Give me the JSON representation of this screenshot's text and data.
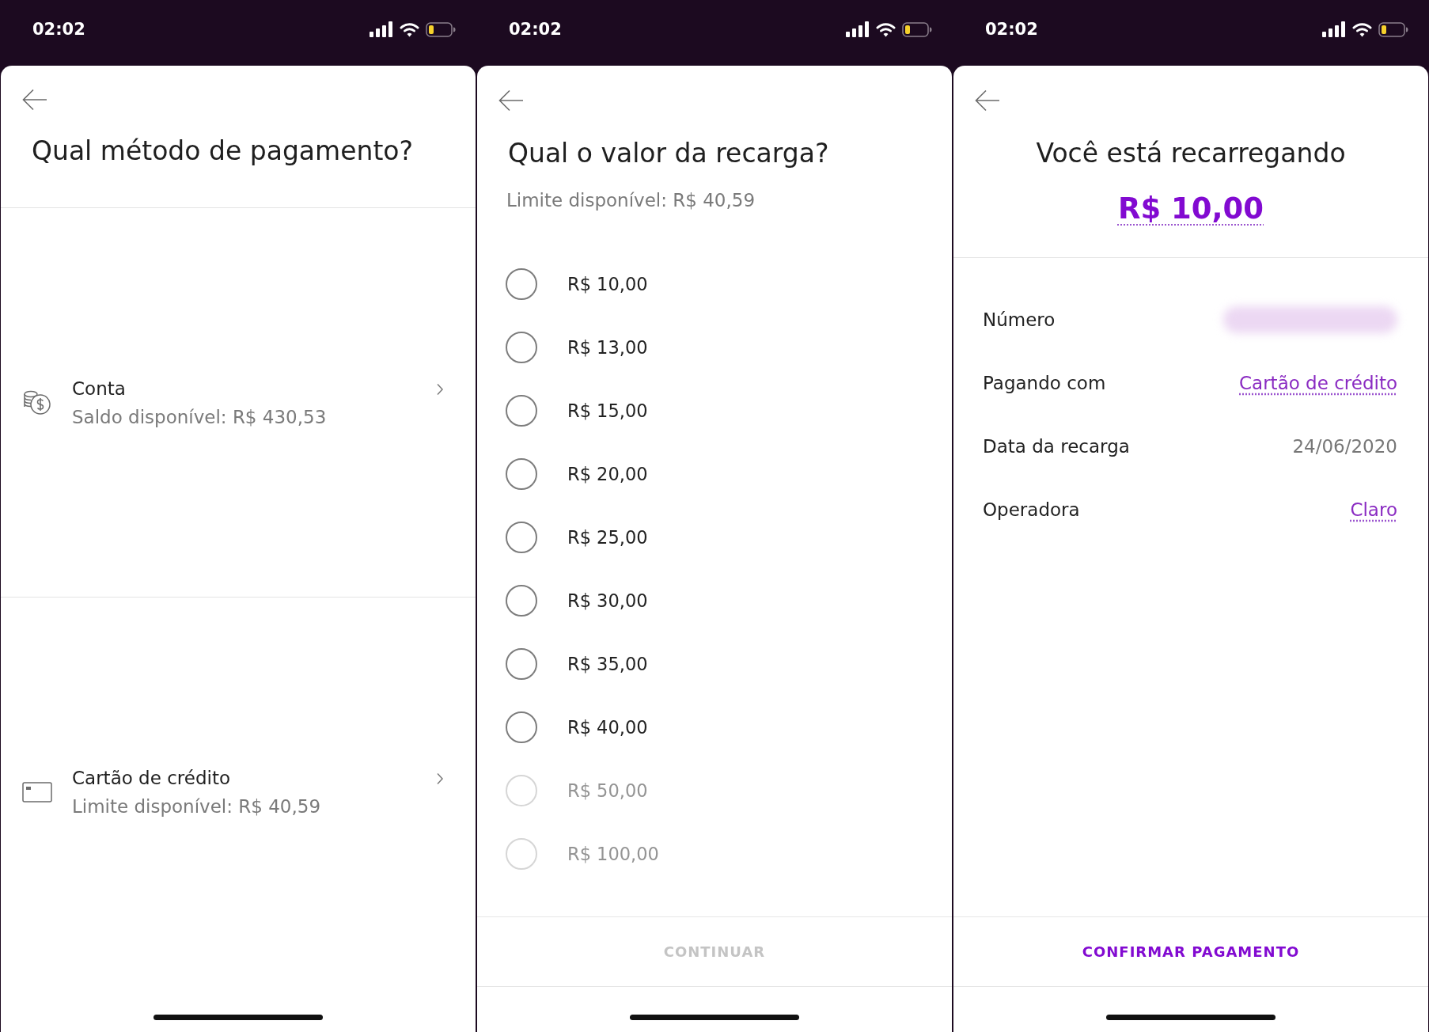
{
  "screens": [
    {
      "kind": "method_list",
      "status_bar": {
        "time": "02:02"
      },
      "title": "Qual método de pagamento?",
      "methods": [
        {
          "kind": "account",
          "label": "Conta",
          "detail": "Saldo disponível: R$ 430,53"
        },
        {
          "kind": "card",
          "label": "Cartão de crédito",
          "detail": "Limite disponível: R$ 40,59"
        }
      ]
    },
    {
      "kind": "amount_picker",
      "status_bar": {
        "time": "02:02"
      },
      "title": "Qual o valor da recarga?",
      "subtitle": "Limite disponível: R$ 40,59",
      "amounts": [
        {
          "label": "R$ 10,00",
          "selected": false,
          "disabled": false
        },
        {
          "label": "R$ 13,00",
          "selected": false,
          "disabled": false
        },
        {
          "label": "R$ 15,00",
          "selected": false,
          "disabled": false
        },
        {
          "label": "R$ 20,00",
          "selected": false,
          "disabled": false
        },
        {
          "label": "R$ 25,00",
          "selected": false,
          "disabled": false
        },
        {
          "label": "R$ 30,00",
          "selected": false,
          "disabled": false
        },
        {
          "label": "R$ 35,00",
          "selected": false,
          "disabled": false
        },
        {
          "label": "R$ 40,00",
          "selected": false,
          "disabled": false
        },
        {
          "label": "R$ 50,00",
          "selected": false,
          "disabled": true
        },
        {
          "label": "R$ 100,00",
          "selected": false,
          "disabled": true
        }
      ],
      "button": {
        "label": "CONTINUAR",
        "disabled": true
      }
    },
    {
      "kind": "confirmation",
      "status_bar": {
        "time": "02:02"
      },
      "title": "Você está recarregando",
      "amount": "R$ 10,00",
      "details": [
        {
          "label": "Número",
          "value_hidden": true
        },
        {
          "label": "Pagando com",
          "value": "Cartão de crédito",
          "link": true
        },
        {
          "label": "Data da recarga",
          "value": "24/06/2020",
          "link": false
        },
        {
          "label": "Operadora",
          "value": "Claro",
          "link": true
        }
      ],
      "button": {
        "label": "CONFIRMAR PAGAMENTO",
        "disabled": false
      }
    }
  ]
}
